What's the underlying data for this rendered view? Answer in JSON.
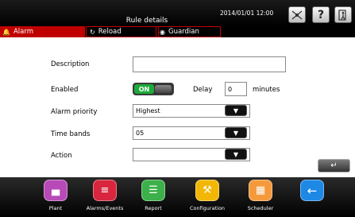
{
  "header": {
    "title": "Rule details",
    "datetime": "2014/01/01  12:00",
    "icons": [
      "network-icon",
      "help-icon",
      "exit-icon"
    ]
  },
  "tabs": [
    {
      "label": "Alarm",
      "icon": "bell-icon",
      "active": true
    },
    {
      "label": "Reload",
      "icon": "reload-icon",
      "active": false
    },
    {
      "label": "Guardian",
      "icon": "guardian-icon",
      "active": false
    }
  ],
  "form": {
    "description": {
      "label": "Description",
      "value": ""
    },
    "enabled": {
      "label": "Enabled",
      "state": "ON"
    },
    "delay": {
      "label": "Delay",
      "value": "0",
      "unit": "minutes"
    },
    "alarm_priority": {
      "label": "Alarm priority",
      "value": "Highest"
    },
    "time_bands": {
      "label": "Time bands",
      "value": "05"
    },
    "action": {
      "label": "Action",
      "value": ""
    }
  },
  "enter_button": {
    "icon": "enter-icon"
  },
  "nav": [
    {
      "label": "Plant",
      "icon": "plant-icon",
      "color": "#b84ab8"
    },
    {
      "label": "Alarms/Events",
      "icon": "alarm-events-icon",
      "color": "#d7263d"
    },
    {
      "label": "Report",
      "icon": "report-icon",
      "color": "#3cb04a"
    },
    {
      "label": "Configuration",
      "icon": "configuration-icon",
      "color": "#f2b705"
    },
    {
      "label": "Scheduler",
      "icon": "scheduler-icon",
      "color": "#f59a3c"
    },
    {
      "label": "",
      "icon": "back-icon",
      "color": "#1e88e5"
    }
  ],
  "colors": {
    "accent": "#c00000",
    "on": "#1faa3b"
  }
}
